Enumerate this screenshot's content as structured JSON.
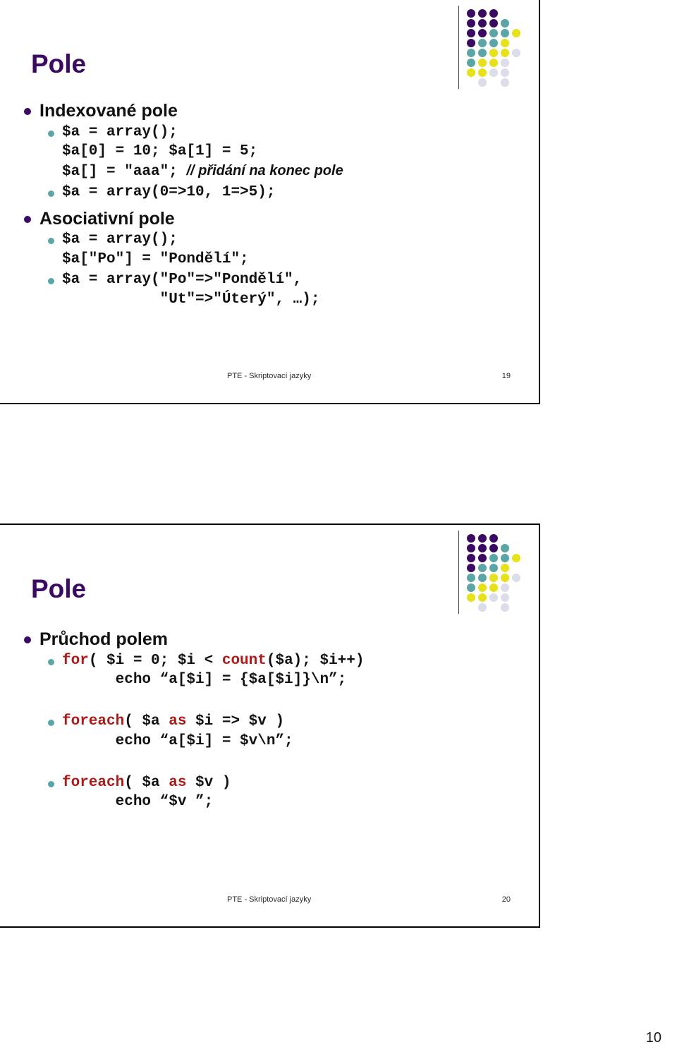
{
  "document": {
    "page_number": "10"
  },
  "logo": {
    "name": "dot-matrix-logo",
    "colors": {
      "purple": "#3b0a63",
      "teal": "#5aa6a6",
      "yellow": "#e6e119",
      "pale": "#dcdcea"
    },
    "grid": [
      [
        "purple",
        "purple",
        "purple",
        "none",
        "none"
      ],
      [
        "purple",
        "purple",
        "purple",
        "teal",
        "none"
      ],
      [
        "purple",
        "purple",
        "teal",
        "teal",
        "yellow"
      ],
      [
        "purple",
        "teal",
        "teal",
        "yellow",
        "none"
      ],
      [
        "teal",
        "teal",
        "yellow",
        "yellow",
        "pale"
      ],
      [
        "teal",
        "yellow",
        "yellow",
        "pale",
        "none"
      ],
      [
        "yellow",
        "yellow",
        "pale",
        "pale",
        "none"
      ],
      [
        "none",
        "pale",
        "none",
        "pale",
        "none"
      ]
    ]
  },
  "slides": [
    {
      "id": "slide-19",
      "title": "Pole",
      "footer_text": "PTE - Skriptovací jazyky",
      "footer_page": "19",
      "sections": [
        {
          "heading": "Indexované pole",
          "items": [
            {
              "lines": [
                "$a = array();",
                "$a[0] = 10; $a[1] = 5;"
              ],
              "code_before": "$a[] = \"aaa\"; ",
              "comment": "// přidání na konec pole"
            },
            {
              "lines": [
                "$a = array(0=>10, 1=>5);"
              ]
            }
          ]
        },
        {
          "heading": "Asociativní pole",
          "items": [
            {
              "lines": [
                "$a = array();",
                "$a[\"Po\"] = \"Pondělí\";"
              ]
            },
            {
              "lines": [
                "$a = array(\"Po\"=>\"Pondělí\",",
                "           \"Ut\"=>\"Úterý\", …);"
              ]
            }
          ]
        }
      ]
    },
    {
      "id": "slide-20",
      "title": "Pole",
      "footer_text": "PTE - Skriptovací jazyky",
      "footer_page": "20",
      "sections": [
        {
          "heading": "Průchod polem",
          "items": [
            {
              "segments": [
                {
                  "text": "for",
                  "keyword": true
                },
                {
                  "text": "( $i = 0; $i < ",
                  "keyword": false
                },
                {
                  "text": "count",
                  "keyword": true
                },
                {
                  "text": "($a); $i++)\n      echo “a[$i] = {$a[$i]}\\n”;",
                  "keyword": false
                }
              ]
            },
            {
              "segments": [
                {
                  "text": "foreach",
                  "keyword": true
                },
                {
                  "text": "( $a ",
                  "keyword": false
                },
                {
                  "text": "as",
                  "keyword": true
                },
                {
                  "text": " $i => $v )\n      echo “a[$i] = $v\\n”;",
                  "keyword": false
                }
              ]
            },
            {
              "segments": [
                {
                  "text": "foreach",
                  "keyword": true
                },
                {
                  "text": "( $a ",
                  "keyword": false
                },
                {
                  "text": "as",
                  "keyword": true
                },
                {
                  "text": " $v )\n      echo “$v ”;",
                  "keyword": false
                }
              ]
            }
          ]
        }
      ]
    }
  ]
}
